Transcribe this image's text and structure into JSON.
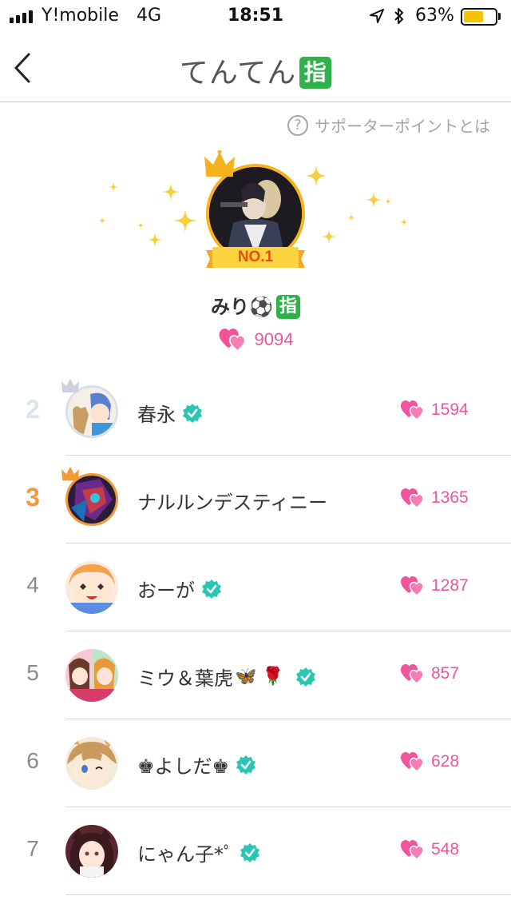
{
  "status_bar": {
    "carrier": "Y!mobile",
    "network": "4G",
    "time": "18:51",
    "battery_percent_label": "63%",
    "battery_level": 0.63
  },
  "nav": {
    "title": "てんてん",
    "title_badge": "指"
  },
  "help": {
    "icon_text": "?",
    "label": "サポーターポイントとは"
  },
  "top_supporter": {
    "rank_label": "NO.1",
    "name": "みり",
    "name_emoji": "⚽",
    "name_badge": "指",
    "points": "9094"
  },
  "ranking": [
    {
      "rank": "2",
      "name": "春永",
      "verified": true,
      "emoji": "",
      "points": "1594"
    },
    {
      "rank": "3",
      "name": "ナルルンデスティニー",
      "verified": false,
      "emoji": "",
      "points": "1365"
    },
    {
      "rank": "4",
      "name": "おーが",
      "verified": true,
      "emoji": "",
      "points": "1287"
    },
    {
      "rank": "5",
      "name": "ミウ＆葉虎",
      "verified": true,
      "emoji": "🦋 🌹",
      "points": "857"
    },
    {
      "rank": "6",
      "name": "♚よしだ♚",
      "verified": true,
      "emoji": "",
      "points": "628"
    },
    {
      "rank": "7",
      "name": "にゃん子*ﾟ",
      "verified": true,
      "emoji": "",
      "points": "548"
    }
  ],
  "colors": {
    "accent_pink": "#f0549a",
    "verified_teal": "#2bc5b4",
    "gold": "#f6b21b",
    "bronze": "#f09a3e",
    "silver": "#dde4ea",
    "badge_green": "#2fb24a"
  }
}
